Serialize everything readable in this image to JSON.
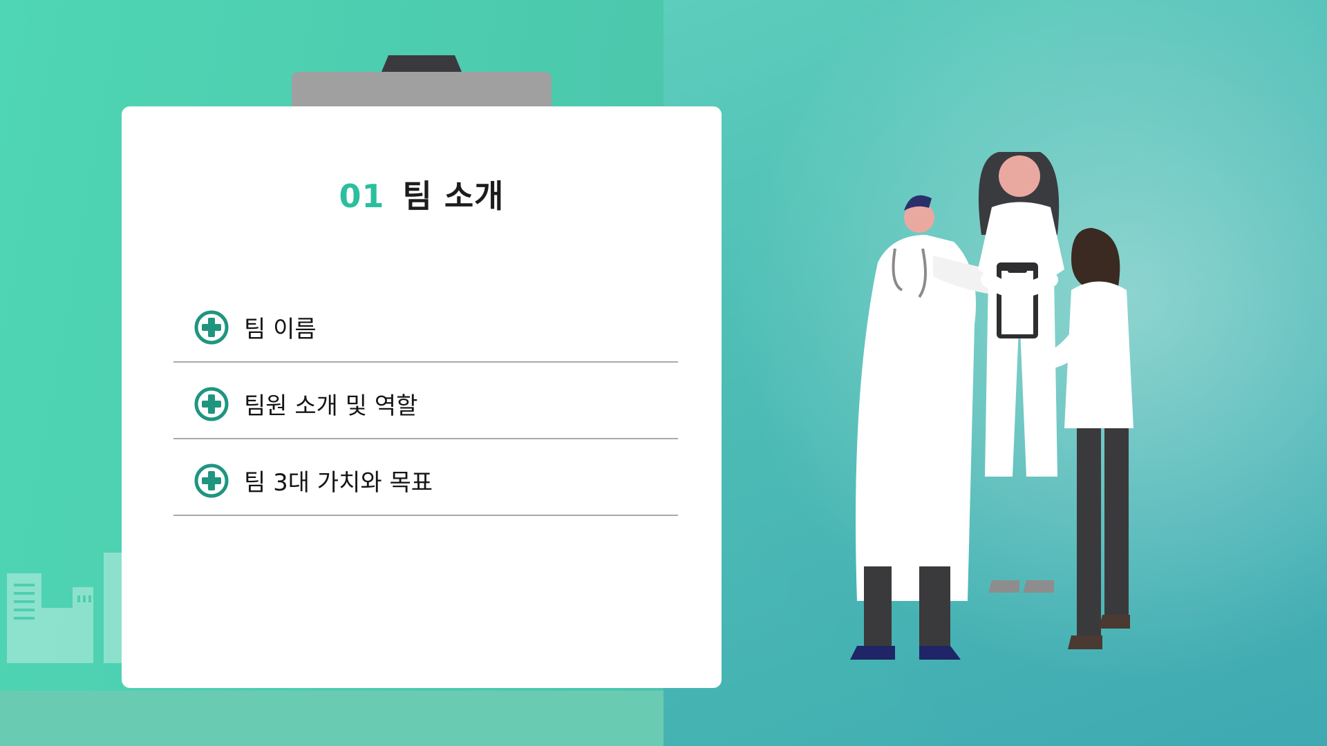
{
  "slide": {
    "number": "01",
    "title": "팀 소개",
    "items": [
      {
        "label": "팀 이름",
        "icon": "plus-circle-icon"
      },
      {
        "label": "팀원 소개 및 역할",
        "icon": "plus-circle-icon"
      },
      {
        "label": "팀 3대 가치와 목표",
        "icon": "plus-circle-icon"
      }
    ]
  },
  "colors": {
    "accent": "#2bbf9e",
    "icon": "#1f9580",
    "background": "#4fd6b4"
  }
}
